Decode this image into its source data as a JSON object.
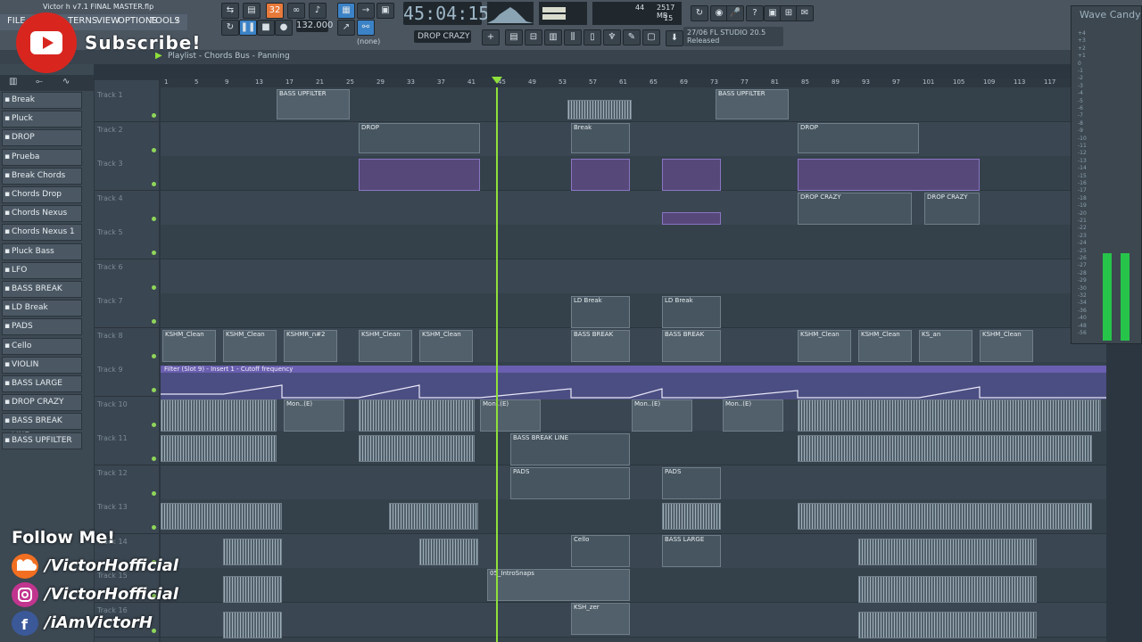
{
  "window": {
    "file_title": "Victor h v7.1 FINAL MASTER.flp"
  },
  "menu": [
    "FILE",
    "TERNS",
    "VIEW",
    "OPTIONS",
    "TOOLS",
    "?"
  ],
  "transport": {
    "time": "45:04:15",
    "bpm": "132.000",
    "pattern_name": "DROP CRAZY",
    "snap": "(none)",
    "cpu": "44",
    "mem": "2517 MB",
    "voices": "15"
  },
  "news": {
    "line1": "27/06  FL STUDIO 20.5",
    "line2": "Released"
  },
  "playlist": {
    "title": "Playlist - Chords Bus - Panning"
  },
  "channels": [
    "Break",
    "Pluck",
    "DROP",
    "Prueba",
    "Break Chords",
    "Chords Drop",
    "Chords Nexus",
    "Chords Nexus 1",
    "Pluck Bass",
    "LFO",
    "BASS BREAK",
    "LD Break",
    "PADS",
    "Cello",
    "VIOLIN",
    "BASS LARGE",
    "DROP CRAZY",
    "BASS BREAK LINE",
    "BASS UPFILTER"
  ],
  "tracks": [
    "Track 1",
    "Track 2",
    "Track 3",
    "Track 4",
    "Track 5",
    "Track 6",
    "Track 7",
    "Track 8",
    "Track 9",
    "Track 10",
    "Track 11",
    "Track 12",
    "Track 13",
    "Track 14",
    "Track 15",
    "Track 16"
  ],
  "ruler": [
    "1",
    "5",
    "9",
    "13",
    "17",
    "21",
    "25",
    "29",
    "33",
    "37",
    "41",
    "45",
    "49",
    "53",
    "57",
    "61",
    "65",
    "69",
    "73",
    "77",
    "81",
    "85",
    "89",
    "93",
    "97",
    "101",
    "105",
    "109",
    "113",
    "117"
  ],
  "clips": {
    "bass_upfilter": "BASS UPFILTER",
    "drop": "DROP",
    "drop_crazy": "DROP CRAZY",
    "ld_break": "LD Break",
    "kshm_clean": "KSHM_Clean",
    "kshmr": "KSHMR_n#2",
    "bass_break": "BASS BREAK",
    "mon": "Mon..(E)",
    "bass_break_line": "BASS BREAK LINE",
    "pads": "PADS",
    "cello": "Cello",
    "bass_large": "BASS LARGE",
    "intro_snaps": "05_IntroSnaps",
    "ksh_zer": "KSH_zer",
    "break": "Break",
    "ks_an": "KS_an"
  },
  "automation": {
    "label": "Filter (Slot 9) - Insert 1 - Cutoff frequency"
  },
  "mixer": {
    "title": "Wave Candy",
    "db_scale": [
      "+4",
      "+3",
      "+2",
      "+1",
      "0",
      "-1",
      "-2",
      "-3",
      "-4",
      "-5",
      "-6",
      "-7",
      "-8",
      "-9",
      "-10",
      "-11",
      "-12",
      "-13",
      "-14",
      "-15",
      "-16",
      "-17",
      "-18",
      "-19",
      "-20",
      "-21",
      "-22",
      "-23",
      "-24",
      "-25",
      "-26",
      "-27",
      "-28",
      "-29",
      "-30",
      "-32",
      "-34",
      "-36",
      "-40",
      "-48",
      "-56"
    ]
  },
  "overlay": {
    "subscribe": "Subscribe!",
    "follow": "Follow Me!",
    "soundcloud": "/VictorHofficial",
    "instagram": "/VictorHofficial",
    "facebook": "/iAmVictorH"
  },
  "colors": {
    "accent_green": "#8fe03a",
    "youtube_red": "#d8261f",
    "soundcloud_orange": "#f26f21",
    "instagram_pink": "#c1358f",
    "facebook_blue": "#3b5998"
  }
}
